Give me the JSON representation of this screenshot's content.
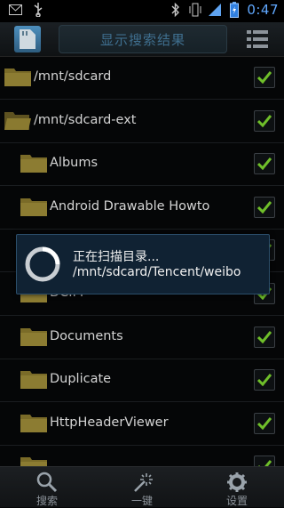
{
  "status_bar": {
    "time": "0:47",
    "icons": [
      "gmail-icon",
      "usb-icon",
      "bluetooth-icon",
      "vibrate-icon",
      "signal-icon",
      "battery-icon"
    ]
  },
  "toolbar": {
    "search_label": "显示搜索结果",
    "app_icon": "sd-card-app-icon",
    "menu_icon": "list-menu-icon"
  },
  "folders": [
    {
      "label": "/mnt/sdcard",
      "checked": true,
      "level": 0
    },
    {
      "label": "/mnt/sdcard-ext",
      "checked": true,
      "level": 0
    },
    {
      "label": "Albums",
      "checked": true,
      "level": 1
    },
    {
      "label": "Android Drawable Howto",
      "checked": true,
      "level": 1
    },
    {
      "label": "",
      "checked": true,
      "level": 1
    },
    {
      "label": "DCIM",
      "checked": true,
      "level": 1
    },
    {
      "label": "Documents",
      "checked": true,
      "level": 1
    },
    {
      "label": "Duplicate",
      "checked": true,
      "level": 1
    },
    {
      "label": "HttpHeaderViewer",
      "checked": true,
      "level": 1
    },
    {
      "label": "",
      "checked": true,
      "level": 1
    }
  ],
  "dialog": {
    "line1": "正在扫描目录...",
    "line2": "/mnt/sdcard/Tencent/weibo"
  },
  "bottom_bar": {
    "items": [
      {
        "label": "搜索",
        "icon": "search-icon"
      },
      {
        "label": "一键",
        "icon": "magic-wand-icon"
      },
      {
        "label": "设置",
        "icon": "gear-icon"
      }
    ]
  },
  "colors": {
    "accent": "#60a8ff",
    "check": "#6fbf2a",
    "folder": "#7e6e2a",
    "dialog_bg": "#102233"
  }
}
